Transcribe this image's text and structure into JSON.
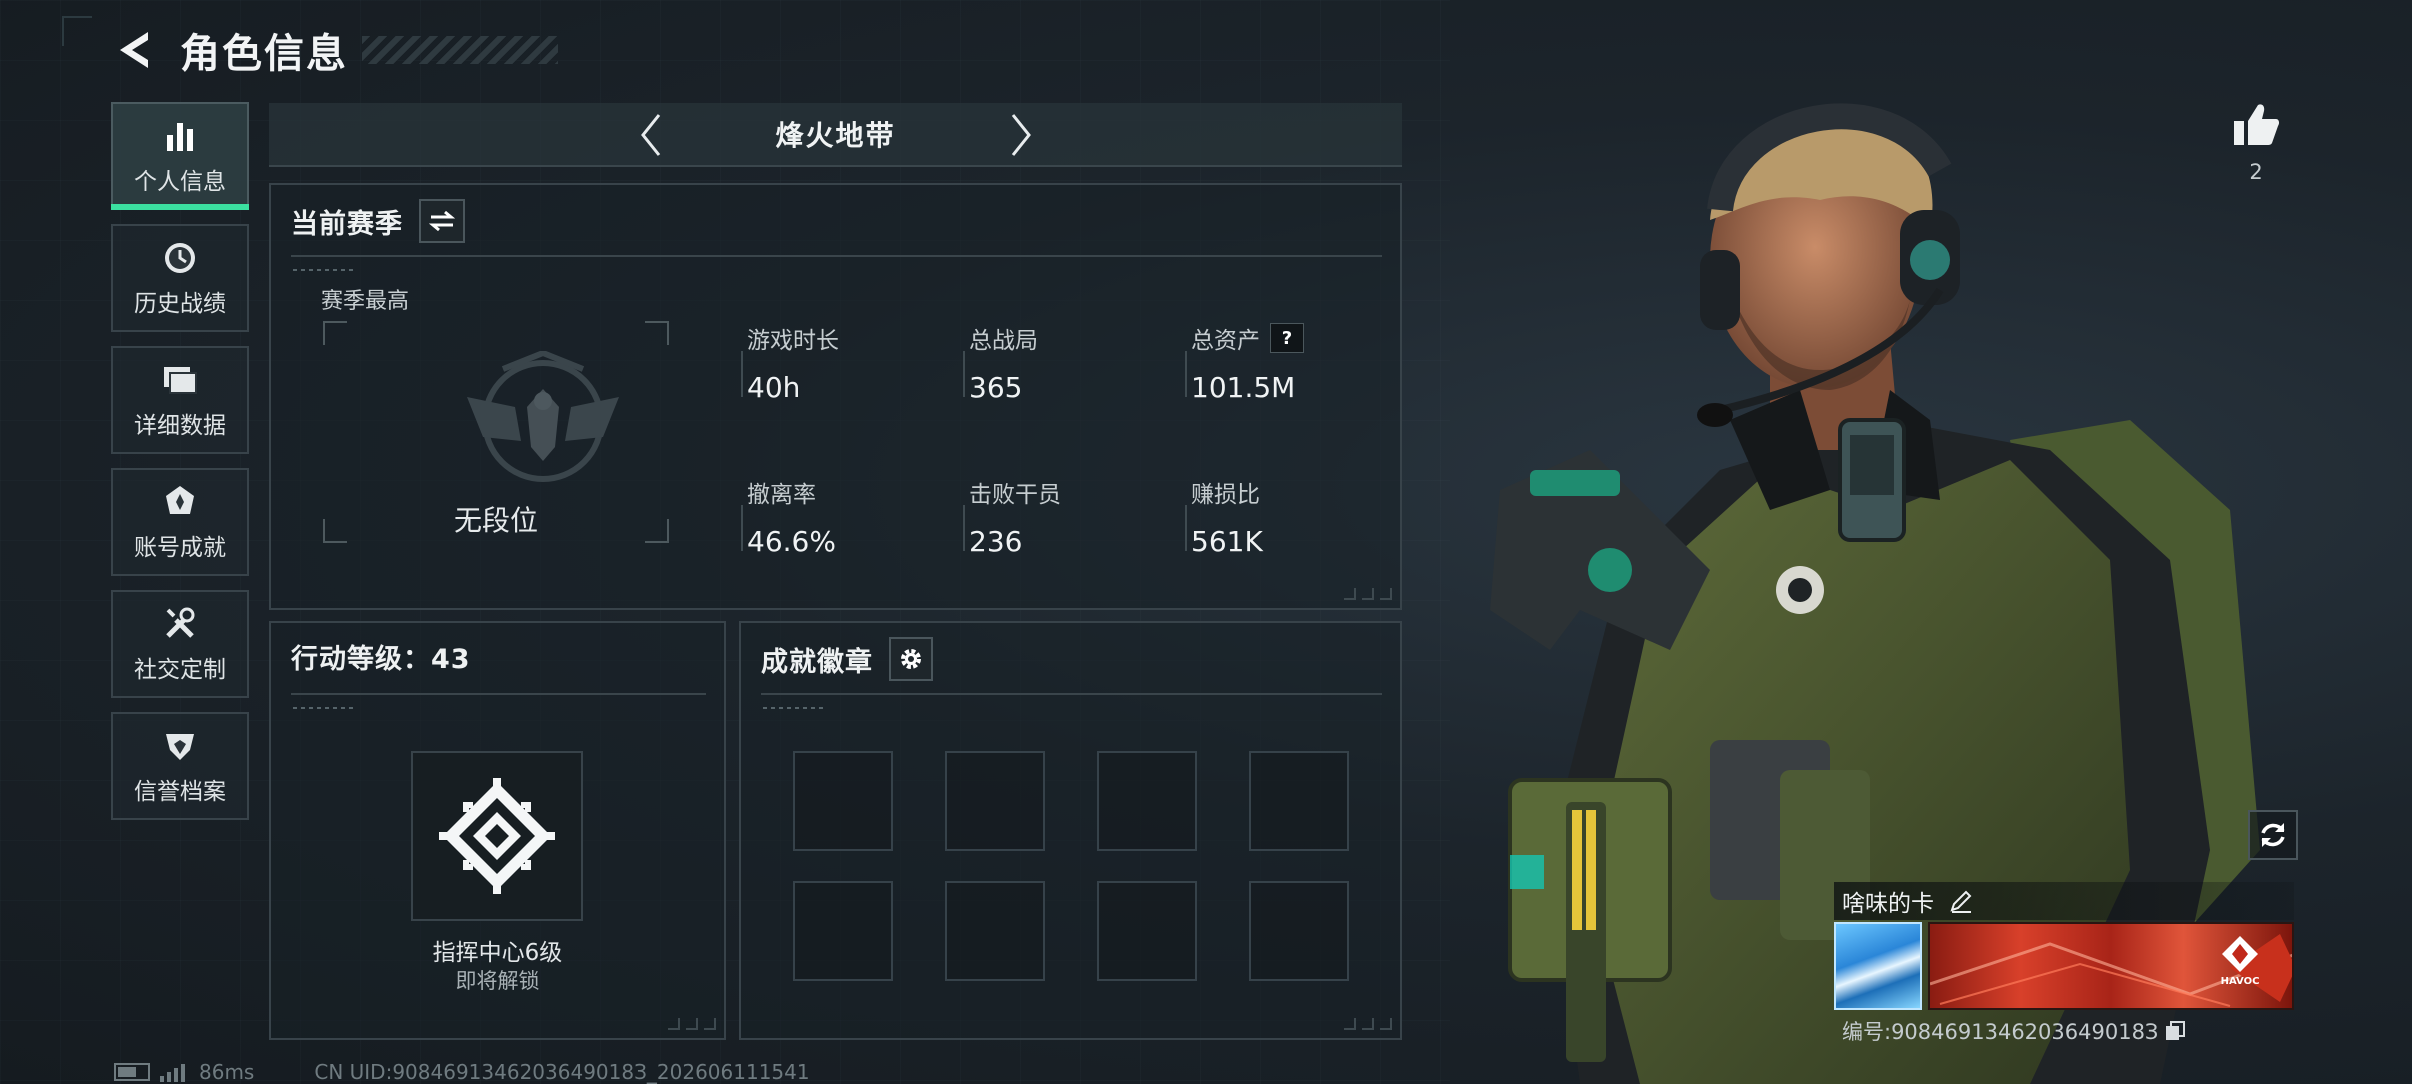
{
  "header": {
    "title": "角色信息"
  },
  "sidebar": {
    "items": [
      {
        "label": "个人信息",
        "icon": "bar-chart-icon"
      },
      {
        "label": "历史战绩",
        "icon": "history-icon"
      },
      {
        "label": "详细数据",
        "icon": "folder-icon"
      },
      {
        "label": "账号成就",
        "icon": "achievement-icon"
      },
      {
        "label": "社交定制",
        "icon": "tools-icon"
      },
      {
        "label": "信誉档案",
        "icon": "shield-icon"
      }
    ],
    "active_index": 0
  },
  "mode": {
    "title": "烽火地带"
  },
  "season": {
    "title": "当前赛季",
    "rank_label": "赛季最高",
    "rank_name": "无段位",
    "stats": [
      {
        "label": "游戏时长",
        "value": "40h"
      },
      {
        "label": "总战局",
        "value": "365"
      },
      {
        "label": "总资产",
        "value": "101.5M",
        "help": "?"
      },
      {
        "label": "撤离率",
        "value": "46.6%"
      },
      {
        "label": "击败干员",
        "value": "236"
      },
      {
        "label": "赚损比",
        "value": "561K"
      }
    ]
  },
  "level": {
    "title": "行动等级：43",
    "card_name": "指挥中心6级",
    "card_status": "即将解锁"
  },
  "badges": {
    "title": "成就徽章",
    "slots": 8
  },
  "profile": {
    "likes": "2",
    "player_name": "啥味的卡",
    "card_id": "编号:9084691346203649018З",
    "banner_logo_text": "HAVOC"
  },
  "footer": {
    "ping": "86ms",
    "uid": "CN UID:9084691346203649018З_202606111541"
  },
  "colors": {
    "accent": "#3be0a0",
    "background": "#1a2128"
  }
}
